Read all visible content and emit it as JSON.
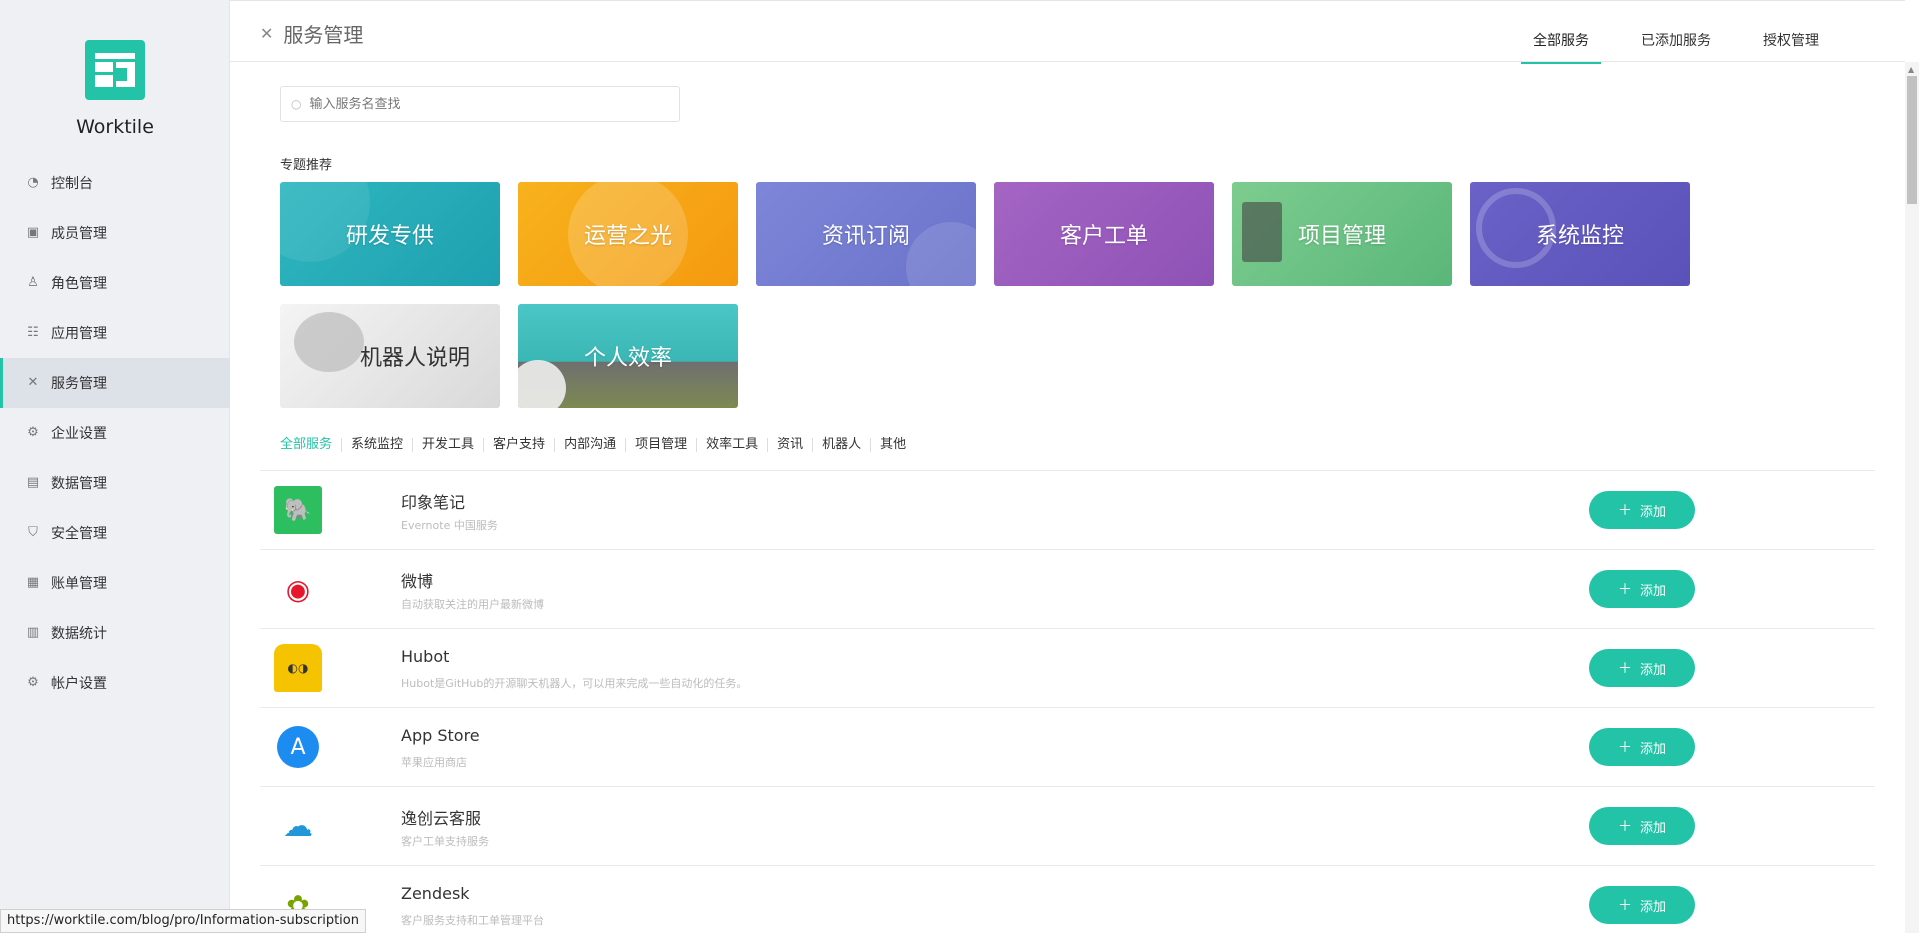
{
  "brand": {
    "name": "Worktile",
    "color": "#22c3a6"
  },
  "sidebar": {
    "items": [
      {
        "label": "控制台",
        "icon": "dashboard-icon"
      },
      {
        "label": "成员管理",
        "icon": "member-icon"
      },
      {
        "label": "角色管理",
        "icon": "role-icon"
      },
      {
        "label": "应用管理",
        "icon": "apps-icon"
      },
      {
        "label": "服务管理",
        "icon": "tools-icon",
        "active": true
      },
      {
        "label": "企业设置",
        "icon": "gear-icon"
      },
      {
        "label": "数据管理",
        "icon": "data-icon"
      },
      {
        "label": "安全管理",
        "icon": "shield-icon"
      },
      {
        "label": "账单管理",
        "icon": "bill-icon"
      },
      {
        "label": "数据统计",
        "icon": "chart-icon"
      },
      {
        "label": "帐户设置",
        "icon": "gear-icon"
      }
    ]
  },
  "header": {
    "title": "服务管理",
    "tabs": [
      {
        "label": "全部服务",
        "active": true
      },
      {
        "label": "已添加服务"
      },
      {
        "label": "授权管理"
      }
    ]
  },
  "search": {
    "placeholder": "输入服务名查找",
    "value": ""
  },
  "topics": {
    "title": "专题推荐",
    "cards": [
      {
        "label": "研发专供"
      },
      {
        "label": "运营之光"
      },
      {
        "label": "资讯订阅"
      },
      {
        "label": "客户工单"
      },
      {
        "label": "项目管理"
      },
      {
        "label": "系统监控"
      },
      {
        "label": "机器人说明"
      },
      {
        "label": "个人效率"
      }
    ]
  },
  "categories": [
    "全部服务",
    "系统监控",
    "开发工具",
    "客户支持",
    "内部沟通",
    "项目管理",
    "效率工具",
    "资讯",
    "机器人",
    "其他"
  ],
  "services": [
    {
      "name": "印象笔记",
      "desc": "Evernote 中国服务",
      "add_label": "添加",
      "icon": "evernote-icon",
      "color": "#2dbe60"
    },
    {
      "name": "微博",
      "desc": "自动获取关注的用户最新微博",
      "add_label": "添加",
      "icon": "weibo-icon",
      "color": "#e6162d"
    },
    {
      "name": "Hubot",
      "desc": "Hubot是GitHub的开源聊天机器人，可以用来完成一些自动化的任务。",
      "add_label": "添加",
      "icon": "hubot-icon",
      "color": "#f5c300"
    },
    {
      "name": "App Store",
      "desc": "苹果应用商店",
      "add_label": "添加",
      "icon": "app-store-icon",
      "color": "#1d8cf0"
    },
    {
      "name": "逸创云客服",
      "desc": "客户工单支持服务",
      "add_label": "添加",
      "icon": "cloud-icon",
      "color": "#2196d8"
    },
    {
      "name": "Zendesk",
      "desc": "客户服务支持和工单管理平台",
      "add_label": "添加",
      "icon": "zendesk-icon",
      "color": "#78a300"
    }
  ],
  "statusbar": {
    "url": "https://worktile.com/blog/pro/Information-subscription"
  }
}
